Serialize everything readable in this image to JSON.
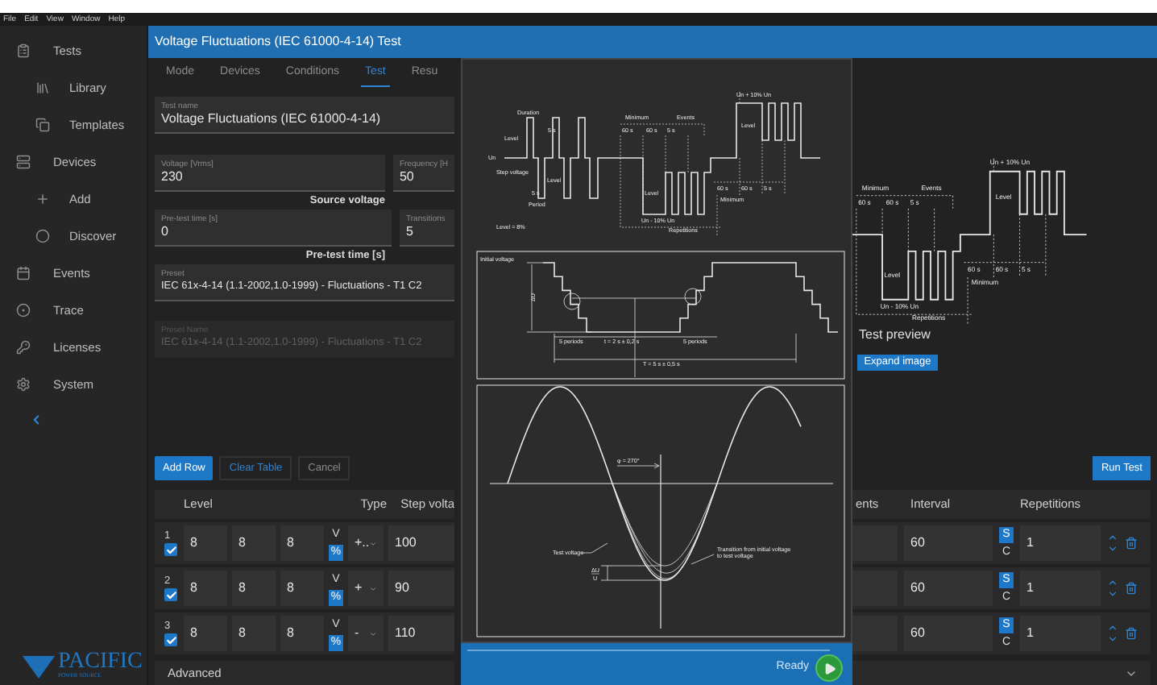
{
  "menu_bar": [
    "File",
    "Edit",
    "View",
    "Window",
    "Help"
  ],
  "sidebar": {
    "items": [
      {
        "label": "Tests",
        "children": [
          {
            "label": "Library"
          },
          {
            "label": "Templates"
          }
        ]
      },
      {
        "label": "Devices",
        "children": [
          {
            "label": "Add"
          },
          {
            "label": "Discover"
          }
        ]
      },
      {
        "label": "Events"
      },
      {
        "label": "Trace"
      },
      {
        "label": "Licenses"
      },
      {
        "label": "System"
      }
    ],
    "logo": {
      "name": "PACIFIC",
      "tagline": "POWER SOURCE"
    }
  },
  "title": "Voltage Fluctuations (IEC 61000-4-14) Test",
  "tabs": [
    {
      "label": "Mode",
      "selected": false
    },
    {
      "label": "Devices",
      "selected": false
    },
    {
      "label": "Conditions",
      "selected": false
    },
    {
      "label": "Test",
      "selected": true
    },
    {
      "label": "Resu",
      "selected": false
    }
  ],
  "form": {
    "test_name": {
      "label": "Test name",
      "value": "Voltage Fluctuations (IEC 61000-4-14)"
    },
    "voltage": {
      "label": "Voltage [Vrms]",
      "value": "230"
    },
    "frequency": {
      "label": "Frequency [H",
      "value": "50"
    },
    "voltage_caption": "Source voltage",
    "pretest": {
      "label": "Pre-test time [s]",
      "value": "0"
    },
    "transitions": {
      "label": "Transitions",
      "value": "5"
    },
    "pretest_caption": "Pre-test time [s]",
    "preset": {
      "label": "Preset",
      "value": "IEC 61x-4-14 (1.1-2002,1.0-1999) - Fluctuations - T1 C2",
      "disabled": false
    },
    "preset_name": {
      "label": "Preset Name",
      "value": "IEC 61x-4-14 (1.1-2002,1.0-1999) - Fluctuations - T1 C2",
      "disabled": true
    }
  },
  "actions": [
    {
      "label": "Add Row",
      "kind": "primary"
    },
    {
      "label": "Clear Table",
      "kind": "link"
    },
    {
      "label": "Cancel",
      "kind": "outline"
    }
  ],
  "run_button": "Run Test",
  "table": {
    "columns": [
      {
        "label": "Level"
      },
      {
        "label": "Type"
      },
      {
        "label": "Step volta"
      },
      {
        "label": "ents"
      },
      {
        "label": "Interval"
      },
      {
        "label": "Repetitions"
      }
    ],
    "rows": [
      {
        "number": "1",
        "checked": true,
        "levels": [
          "8",
          "8",
          "8"
        ],
        "units": [
          {
            "label": "V",
            "selected": false
          },
          {
            "label": "%",
            "selected": true
          }
        ],
        "type": "+..",
        "step": "100",
        "interval": "60",
        "modes": [
          {
            "label": "S",
            "selected": true
          },
          {
            "label": "C",
            "selected": false
          }
        ],
        "repetitions": "1"
      },
      {
        "number": "2",
        "checked": true,
        "levels": [
          "8",
          "8",
          "8"
        ],
        "units": [
          {
            "label": "V",
            "selected": false
          },
          {
            "label": "%",
            "selected": true
          }
        ],
        "type": "+",
        "step": "90",
        "interval": "60",
        "modes": [
          {
            "label": "S",
            "selected": true
          },
          {
            "label": "C",
            "selected": false
          }
        ],
        "repetitions": "1"
      },
      {
        "number": "3",
        "checked": true,
        "levels": [
          "8",
          "8",
          "8"
        ],
        "units": [
          {
            "label": "V",
            "selected": false
          },
          {
            "label": "%",
            "selected": true
          }
        ],
        "type": "-",
        "step": "110",
        "interval": "60",
        "modes": [
          {
            "label": "S",
            "selected": true
          },
          {
            "label": "C",
            "selected": false
          }
        ],
        "repetitions": "1"
      }
    ]
  },
  "advanced": "Advanced",
  "preview": {
    "labels": [
      "Minimum",
      "Events",
      "60 s",
      "60 s",
      "5 s",
      "Level",
      "Un - 10% Un",
      "Repetitions",
      "60 s",
      "60 s",
      "5 s",
      "Minimum",
      "Un + 10% Un",
      "Level"
    ],
    "caption": "Test preview",
    "button": "Expand image"
  },
  "overlay": {
    "waveform_labels": [
      "Duration",
      "5 s",
      "Level",
      "Un",
      "Step voltage",
      "Level",
      "5 s",
      "Period",
      "Level = 8%",
      "Minimum",
      "Events",
      "60 s",
      "60 s",
      "5 s",
      "Level",
      "Un - 10% Un",
      "Repetitions",
      "60 s",
      "60 s",
      "5 s",
      "Minimum",
      "Un + 10% Un",
      "Level"
    ],
    "step_labels": [
      "Initial voltage",
      "ΔU",
      "5 periods",
      "t = 2 s ± 0,2 s",
      "5 periods",
      "T = 5 s ± 0,5 s"
    ],
    "sine_labels": [
      "φ = 270°",
      "Test voltage",
      "Transition from initial voltage to test voltage"
    ],
    "fraction": {
      "numerator": "ΔU",
      "denominator": "U"
    }
  },
  "status": {
    "text": "Ready"
  }
}
